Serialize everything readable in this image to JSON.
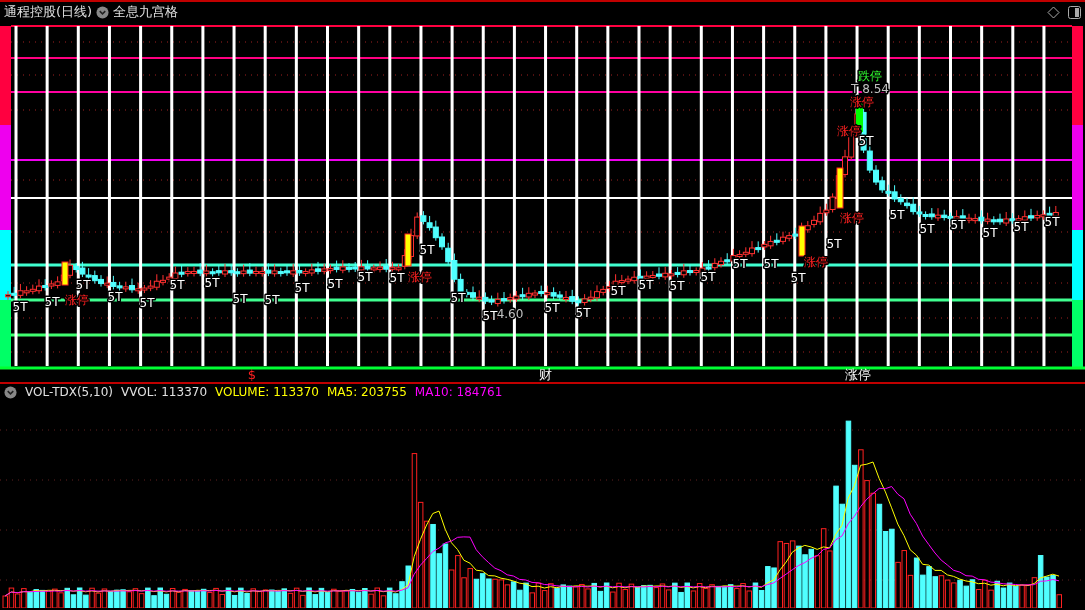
{
  "header": {
    "title": "通程控股(日线)",
    "view": "全息九宫格"
  },
  "labels": [
    {
      "kind": "t5",
      "text": "5T"
    },
    {
      "kind": "t5",
      "text": "5T"
    },
    {
      "kind": "t5",
      "text": "5T"
    },
    {
      "kind": "t5",
      "text": "5T"
    },
    {
      "kind": "t5",
      "text": "5T"
    },
    {
      "kind": "t5",
      "text": "5T"
    },
    {
      "kind": "t5",
      "text": "5T"
    },
    {
      "kind": "t5",
      "text": "5T"
    },
    {
      "kind": "t5",
      "text": "5T"
    },
    {
      "kind": "t5",
      "text": "5T"
    },
    {
      "kind": "t5",
      "text": "5T"
    },
    {
      "kind": "t5",
      "text": "5T"
    },
    {
      "kind": "t5",
      "text": "5T"
    },
    {
      "kind": "limit-up",
      "text": "涨停"
    },
    {
      "kind": "limit-up",
      "text": "涨停"
    },
    {
      "kind": "t5",
      "text": "5T"
    },
    {
      "kind": "t5",
      "text": "5T"
    },
    {
      "kind": "t5",
      "text": "5T"
    },
    {
      "kind": "price",
      "text": "4.60"
    },
    {
      "kind": "t5",
      "text": "5T"
    },
    {
      "kind": "t5",
      "text": "5T"
    },
    {
      "kind": "t5",
      "text": "5T"
    },
    {
      "kind": "t5",
      "text": "5T"
    },
    {
      "kind": "t5",
      "text": "5T"
    },
    {
      "kind": "t5",
      "text": "5T"
    },
    {
      "kind": "t5",
      "text": "5T"
    },
    {
      "kind": "t5",
      "text": "5T"
    },
    {
      "kind": "t5",
      "text": "5T"
    },
    {
      "kind": "t5",
      "text": "5T"
    },
    {
      "kind": "t5",
      "text": "5T"
    },
    {
      "kind": "t5",
      "text": "5T"
    },
    {
      "kind": "t5",
      "text": "5T"
    },
    {
      "kind": "t5",
      "text": "5T"
    },
    {
      "kind": "t5",
      "text": "5T"
    },
    {
      "kind": "t5",
      "text": "5T"
    },
    {
      "kind": "t5",
      "text": "5T"
    },
    {
      "kind": "limit-up",
      "text": "涨停"
    },
    {
      "kind": "limit-down",
      "text": "跌停"
    },
    {
      "kind": "price",
      "text": "T 8.54"
    },
    {
      "kind": "limit-up",
      "text": "涨停"
    },
    {
      "kind": "limit-up",
      "text": "涨停"
    },
    {
      "kind": "limit-up",
      "text": "涨停"
    }
  ],
  "events": [
    {
      "text": "$",
      "color": "#ff2020"
    },
    {
      "text": "财",
      "color": "#ffffff"
    },
    {
      "text": "涨停",
      "color": "#ffffff"
    }
  ],
  "indicator": {
    "name": "VOL-TDX(5,10)",
    "values": [
      {
        "text": "VVOL: 113370",
        "color": "#e0e0e0"
      },
      {
        "text": "VOLUME: 113370",
        "color": "#ffff00"
      },
      {
        "text": "MA5: 203755",
        "color": "#ffff00"
      },
      {
        "text": "MA10: 184761",
        "color": "#ff00ff"
      }
    ]
  }
}
